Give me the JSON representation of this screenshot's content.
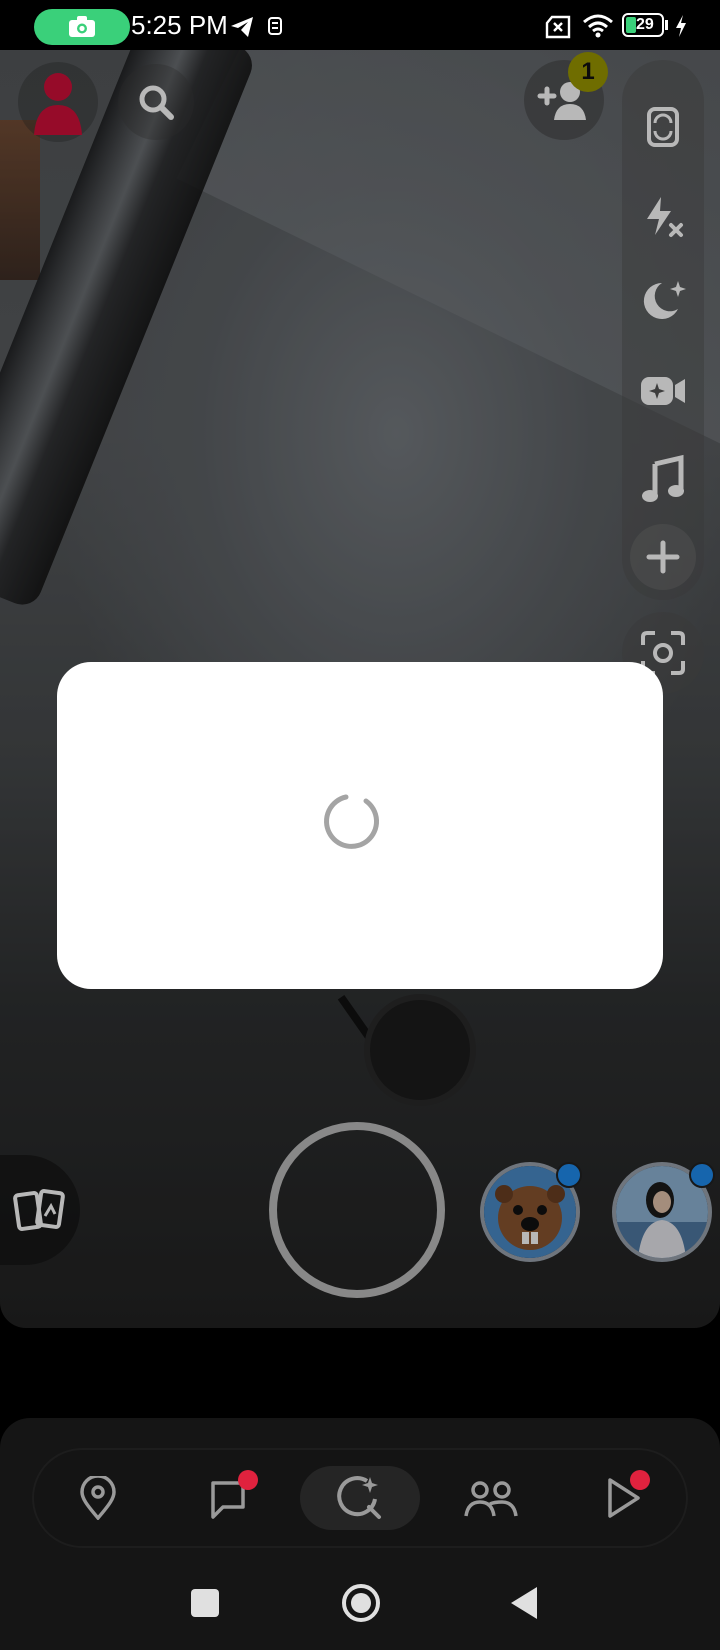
{
  "status_bar": {
    "time": "5:25 PM",
    "battery": "29",
    "icons": [
      "screen-recorder-icon",
      "telegram-icon",
      "alarm-icon",
      "no-sim-icon",
      "wifi-icon",
      "battery-icon",
      "charging-icon"
    ]
  },
  "camera": {
    "friend_requests_badge": "1",
    "toolbar_icons": [
      "flip-camera-icon",
      "flash-off-icon",
      "night-mode-icon",
      "video-icon",
      "music-icon",
      "plus-icon",
      "scan-icon"
    ]
  },
  "dialog": {
    "state": "loading"
  },
  "stories": [
    {
      "name": "beaver-bitmoji"
    },
    {
      "name": "girl-portrait"
    }
  ],
  "bottom_nav": {
    "items": [
      "map",
      "chat",
      "camera",
      "stories",
      "spotlight"
    ],
    "active": "camera"
  },
  "colors": {
    "accent_green": "#3ad07a",
    "badge_yellow": "#9a9700",
    "notif_red": "#e0223e",
    "story_blue": "#1f8cf0"
  }
}
